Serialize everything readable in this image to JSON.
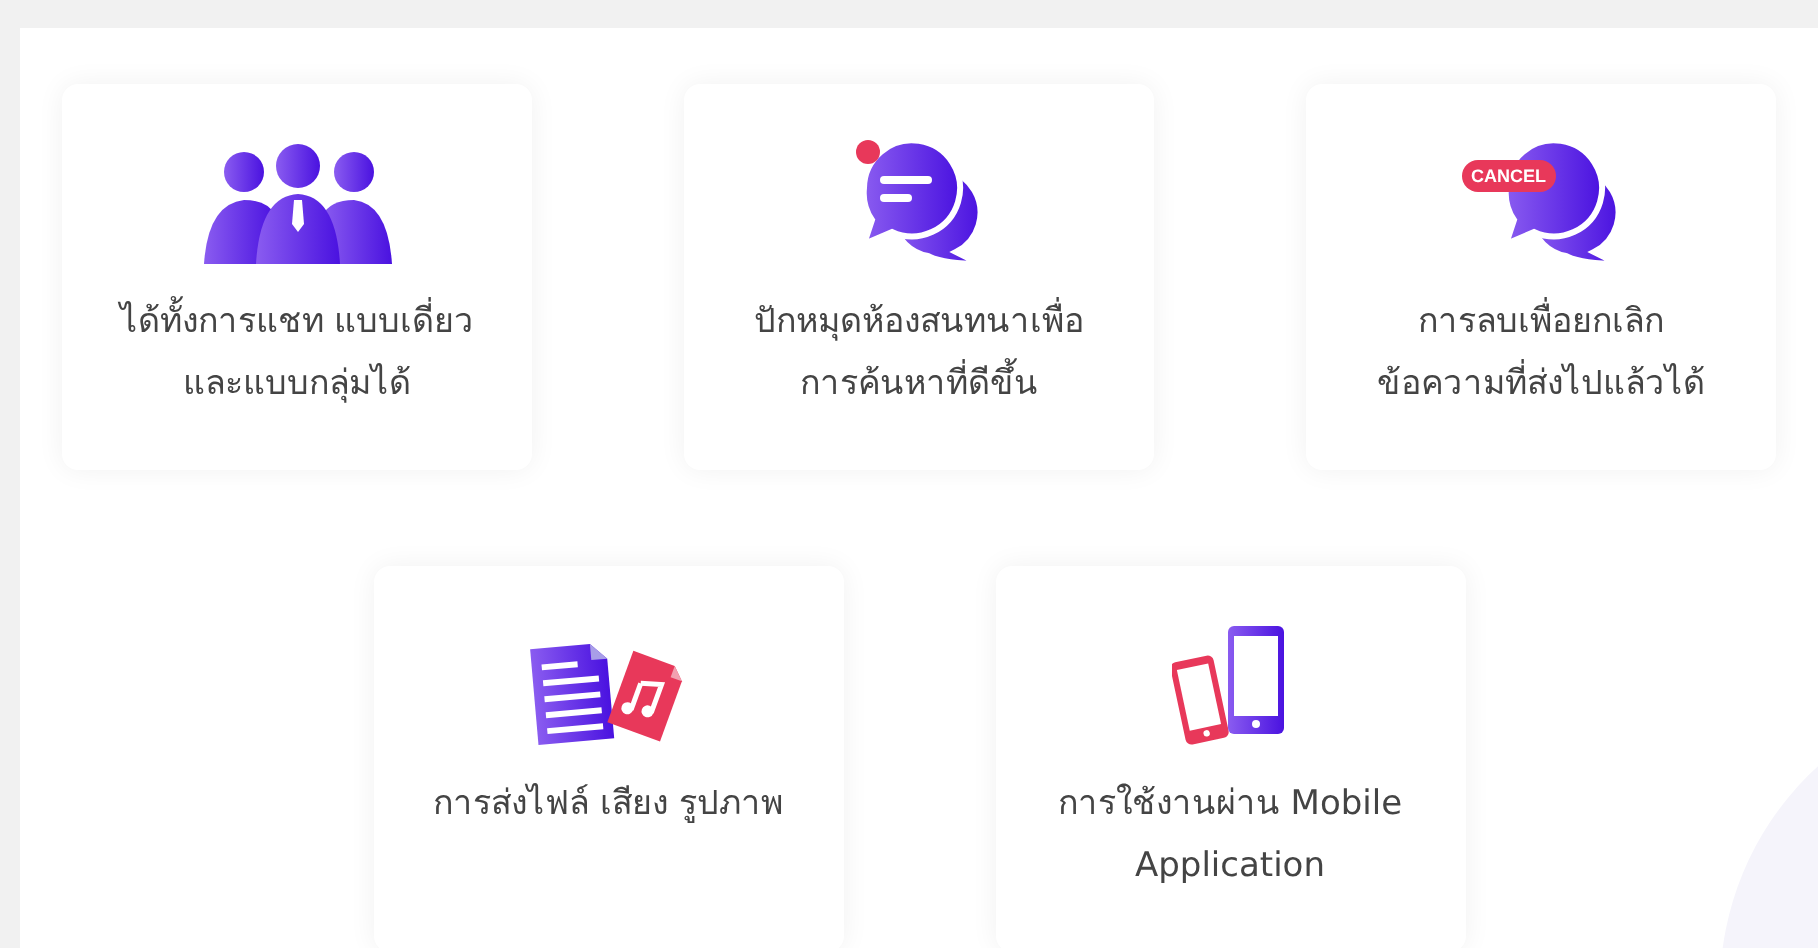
{
  "rows": [
    {
      "features": [
        {
          "kind": "people",
          "lines": [
            "ได้ทั้งการแชท แบบเดี่ยว",
            "และแบบกลุ่มได้"
          ]
        },
        {
          "kind": "pin",
          "lines": [
            "ปักหมุดห้องสนทนาเพื่อ",
            "การค้นหาที่ดีขึ้น"
          ]
        },
        {
          "kind": "cancel",
          "badge": "CANCEL",
          "lines": [
            "การลบเพื่อยกเลิก",
            "ข้อความที่ส่งไปแล้วได้"
          ]
        }
      ]
    },
    {
      "features": [
        {
          "kind": "files",
          "lines": [
            "การส่งไฟล์ เสียง รูปภาพ"
          ]
        },
        {
          "kind": "mobile",
          "lines": [
            "การใช้งานผ่าน Mobile",
            "Application"
          ]
        }
      ]
    }
  ]
}
